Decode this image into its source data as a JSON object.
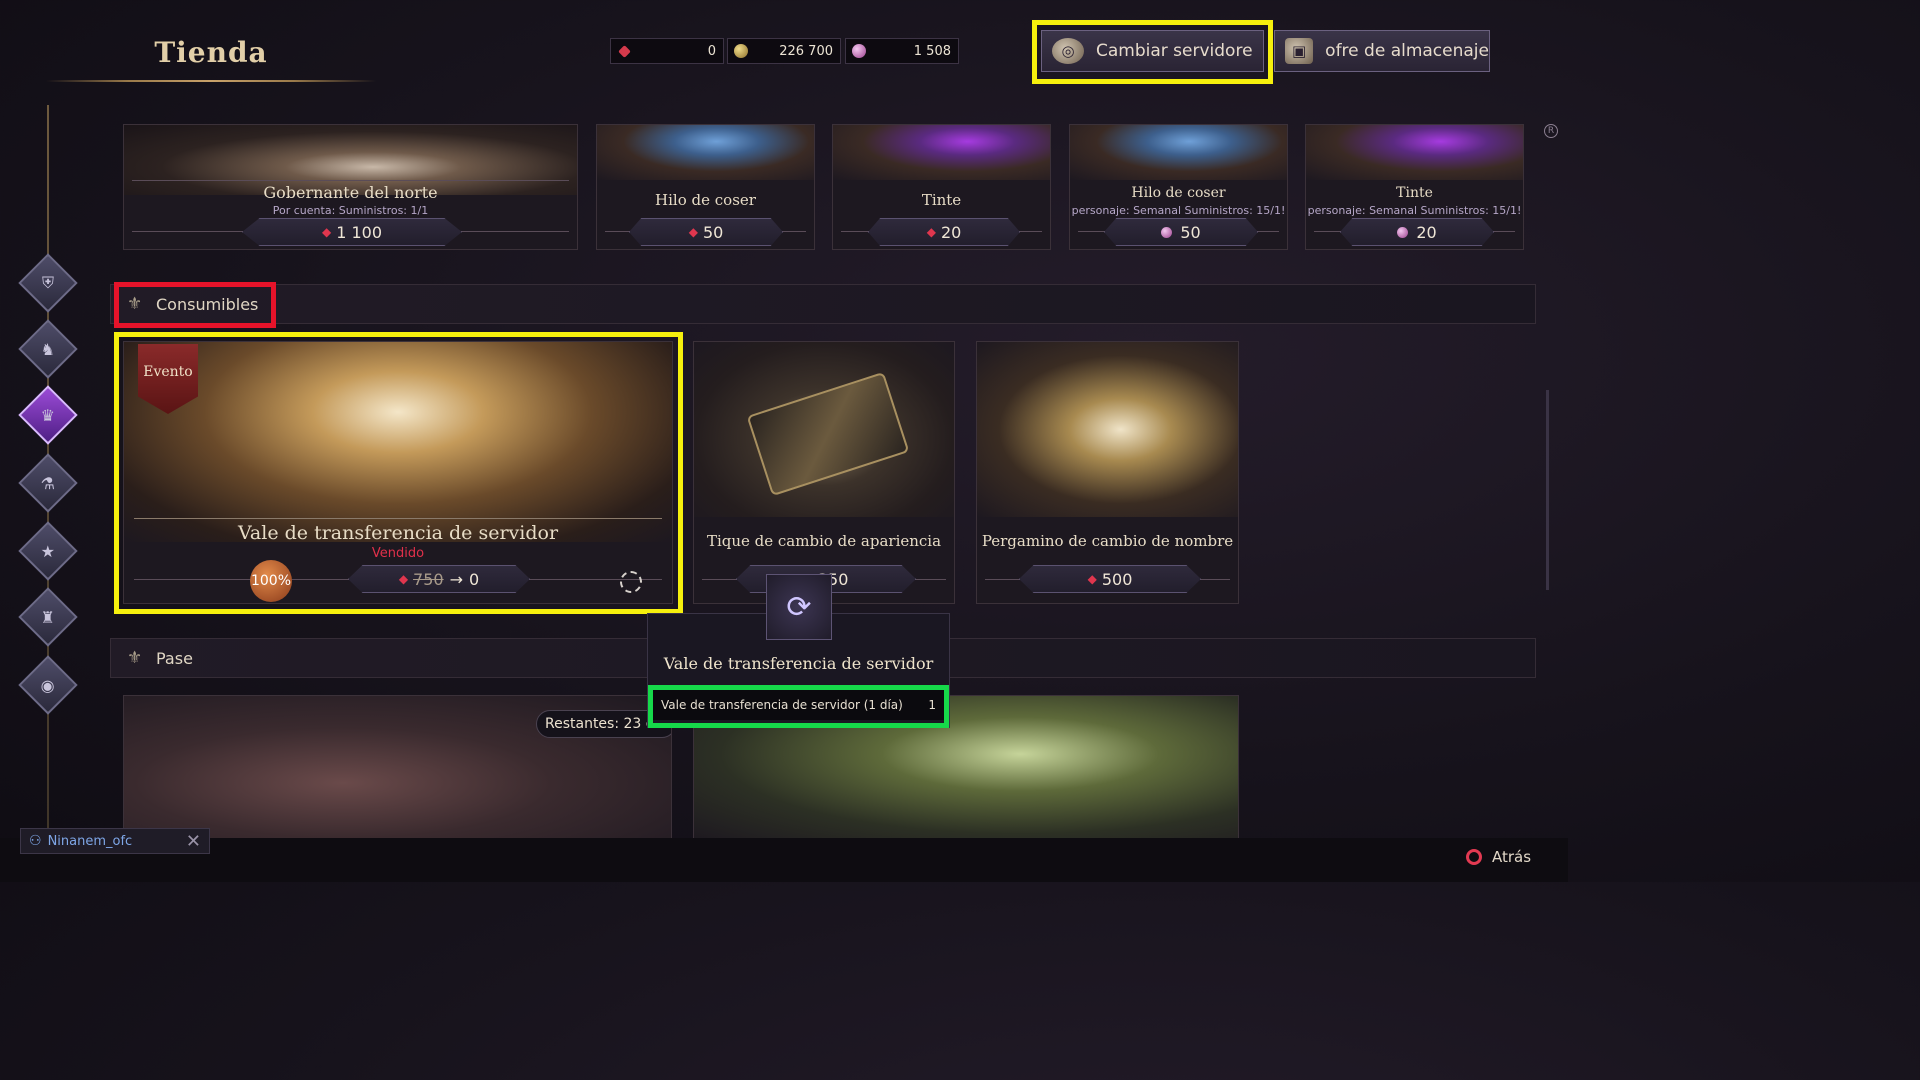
{
  "header": {
    "title": "Tienda",
    "currencies": [
      {
        "icon": "ruby-icon",
        "value": "0"
      },
      {
        "icon": "gold-coin-icon",
        "value": "226 700"
      },
      {
        "icon": "gem-icon",
        "value": "1 508"
      }
    ],
    "change_server_label": "Cambiar servidore",
    "storage_label": "ofre de almacenaje"
  },
  "nav": {
    "items": [
      {
        "icon": "shield-icon"
      },
      {
        "icon": "character-icon"
      },
      {
        "icon": "hat-icon",
        "active": true
      },
      {
        "icon": "potion-icon"
      },
      {
        "icon": "star-icon"
      },
      {
        "icon": "top-hat-icon"
      },
      {
        "icon": "coins-icon"
      }
    ]
  },
  "top_row": [
    {
      "name": "Gobernante del norte",
      "sub": "Por cuenta:   Suministros: 1/1",
      "currency": "ruby",
      "price": "1 100"
    },
    {
      "name": "Hilo de coser",
      "sub": "",
      "currency": "ruby",
      "price": "50"
    },
    {
      "name": "Tinte",
      "sub": "",
      "currency": "ruby",
      "price": "20"
    },
    {
      "name": "Hilo de coser",
      "sub": "personaje:   Semanal Suministros: 15/1!",
      "currency": "gem",
      "price": "50"
    },
    {
      "name": "Tinte",
      "sub": "personaje:   Semanal Suministros: 15/1!",
      "currency": "gem",
      "price": "20"
    }
  ],
  "sections": {
    "consumables": "Consumibles",
    "pass": "Pase"
  },
  "consumables": [
    {
      "name": "Vale de transferencia de servidor",
      "status": "Vendido",
      "badge": "Evento",
      "discount": "100%",
      "old_price": "750",
      "price": "0"
    },
    {
      "name": "Tique de cambio de apariencia",
      "price": "350"
    },
    {
      "name": "Pergamino de cambio de nombre",
      "price": "500"
    }
  ],
  "pass": {
    "remaining": "Restantes: 23 c"
  },
  "tooltip": {
    "title": "Vale de transferencia de servidor",
    "item": "Vale de transferencia de servidor (1 día)",
    "qty": "1"
  },
  "footer": {
    "user": "Ninanem_ofc",
    "back_label": "Atrás"
  },
  "colors": {
    "highlight_yellow": "#f6f00d",
    "highlight_red": "#e6132a",
    "highlight_green": "#16d94a"
  }
}
